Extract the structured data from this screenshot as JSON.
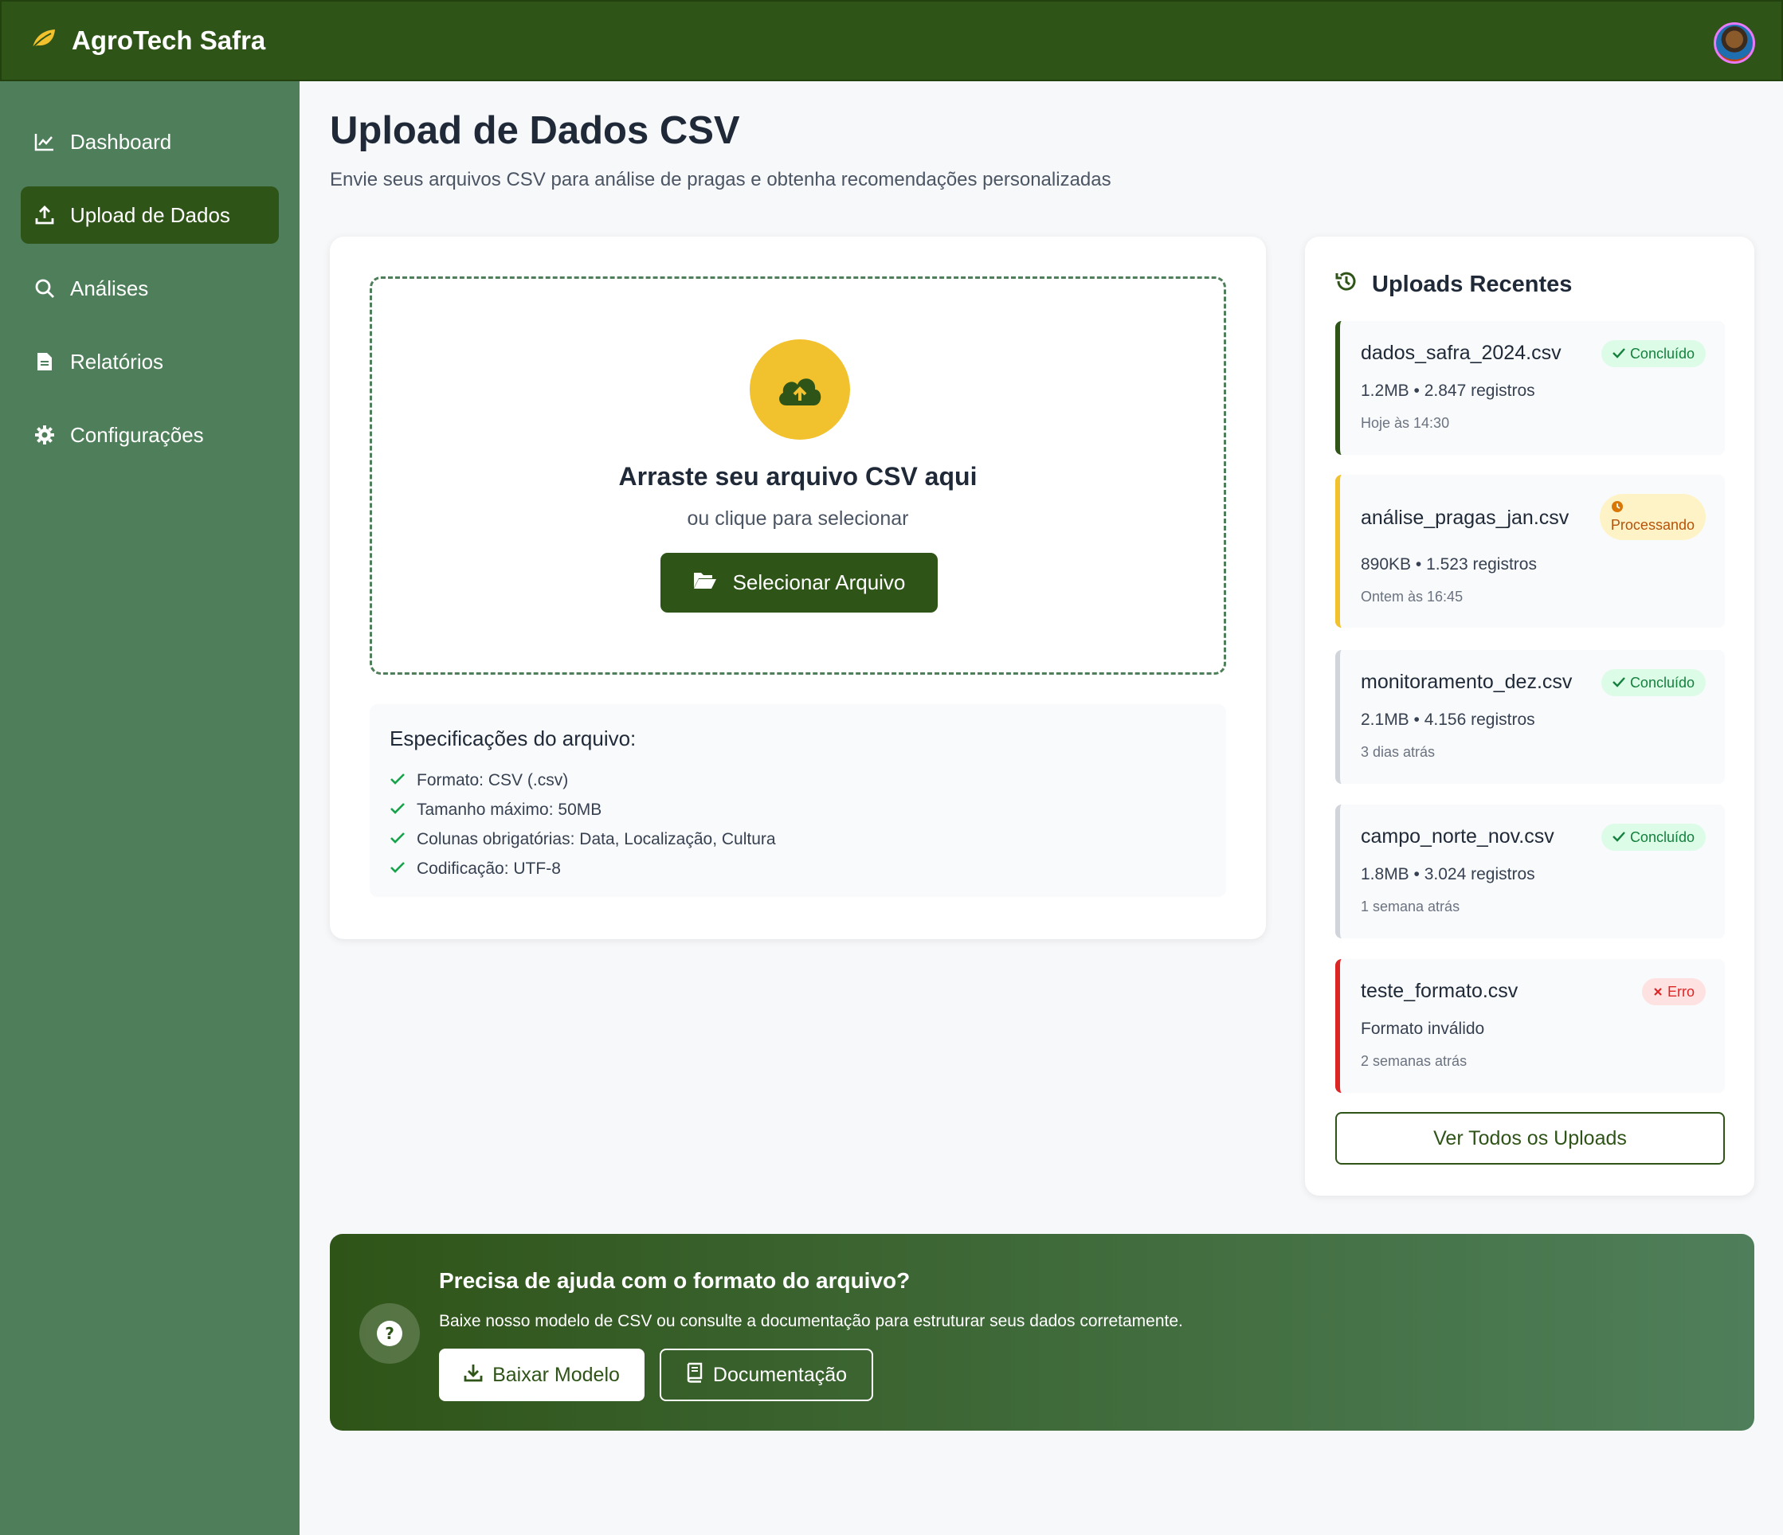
{
  "header": {
    "app_name": "AgroTech Safra",
    "logo_icon": "leaf-icon",
    "avatar_icon": "user-avatar"
  },
  "sidebar": {
    "items": [
      {
        "label": "Dashboard",
        "icon": "chart-line-icon"
      },
      {
        "label": "Upload de Dados",
        "icon": "upload-icon",
        "active": true
      },
      {
        "label": "Análises",
        "icon": "search-icon"
      },
      {
        "label": "Relatórios",
        "icon": "file-icon"
      },
      {
        "label": "Configurações",
        "icon": "gear-icon"
      }
    ]
  },
  "page": {
    "title": "Upload de Dados CSV",
    "subtitle": "Envie seus arquivos CSV para análise de pragas e obtenha recomendações personalizadas"
  },
  "dropzone": {
    "title": "Arraste seu arquivo CSV aqui",
    "subtitle": "ou clique para selecionar",
    "button_label": "Selecionar Arquivo"
  },
  "specs": {
    "title": "Especificações do arquivo:",
    "items": [
      "Formato: CSV (.csv)",
      "Tamanho máximo: 50MB",
      "Colunas obrigatórias: Data, Localização, Cultura",
      "Codificação: UTF-8"
    ]
  },
  "recent": {
    "title": "Uploads Recentes",
    "items": [
      {
        "name": "dados_safra_2024.csv",
        "meta": "1.2MB • 2.847 registros",
        "time": "Hoje às 14:30",
        "status": "Concluído",
        "status_type": "ok"
      },
      {
        "name": "análise_pragas_jan.csv",
        "meta": "890KB • 1.523 registros",
        "time": "Ontem às 16:45",
        "status": "Processando",
        "status_type": "proc"
      },
      {
        "name": "monitoramento_dez.csv",
        "meta": "2.1MB • 4.156 registros",
        "time": "3 dias atrás",
        "status": "Concluído",
        "status_type": "ok"
      },
      {
        "name": "campo_norte_nov.csv",
        "meta": "1.8MB • 3.024 registros",
        "time": "1 semana atrás",
        "status": "Concluído",
        "status_type": "ok"
      },
      {
        "name": "teste_formato.csv",
        "meta": "Formato inválido",
        "time": "2 semanas atrás",
        "status": "Erro",
        "status_type": "err"
      }
    ],
    "view_all_label": "Ver Todos os Uploads"
  },
  "help": {
    "title": "Precisa de ajuda com o formato do arquivo?",
    "text": "Baixe nosso modelo de CSV ou consulte a documentação para estruturar seus dados corretamente.",
    "download_label": "Baixar Modelo",
    "docs_label": "Documentação"
  },
  "colors": {
    "primary": "#2f5418",
    "sidebar": "#4f7f5a",
    "accent_yellow": "#f2c12e",
    "success": "#15803d",
    "warning": "#b45309",
    "error": "#dc2626"
  }
}
